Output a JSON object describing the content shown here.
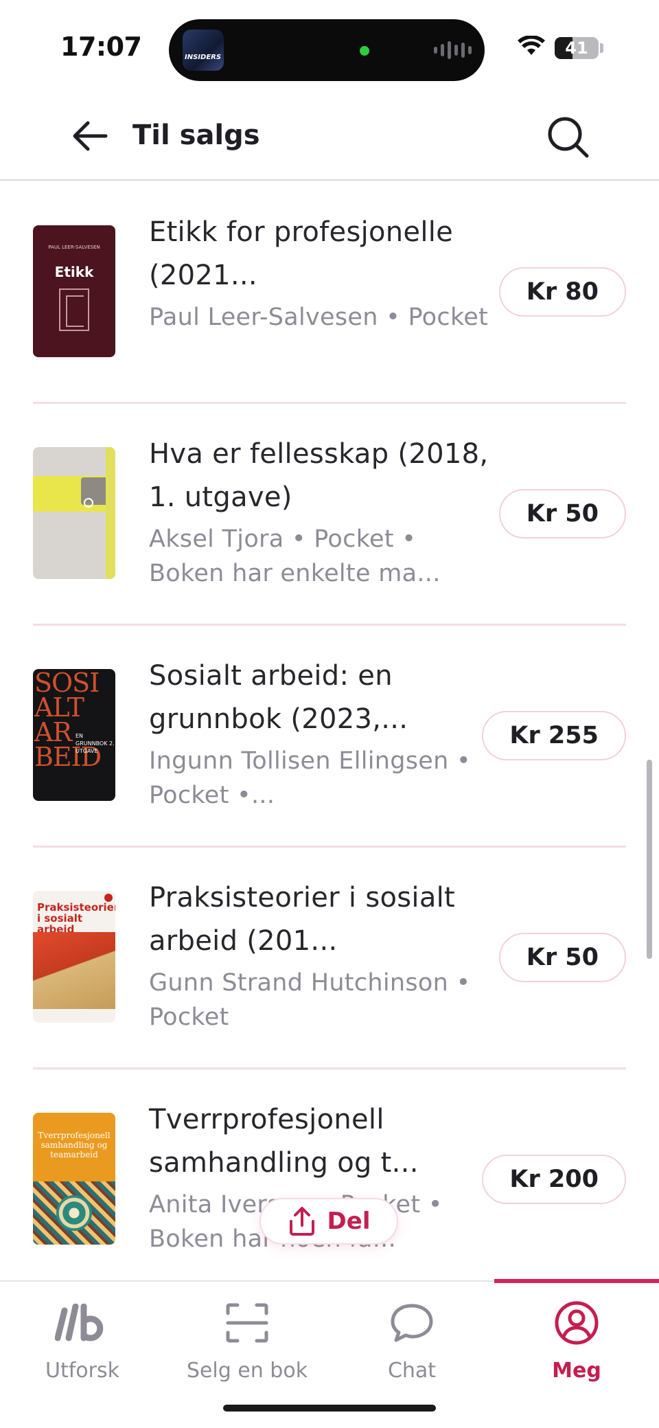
{
  "status_bar": {
    "time": "17:07",
    "battery": "41",
    "media_label": "INSIDERS"
  },
  "header": {
    "title": "Til salgs"
  },
  "listings": [
    {
      "title": "Etikk for profesjonelle (2021...",
      "meta": "Paul Leer-Salvesen • Pocket",
      "price": "Kr 80"
    },
    {
      "title": "Hva er fellesskap (2018, 1. utgave)",
      "meta": "Aksel Tjora • Pocket • Boken har enkelte ma...",
      "price": "Kr 50"
    },
    {
      "title": "Sosialt arbeid: en grunnbok (2023,...",
      "meta": "Ingunn Tollisen Ellingsen • Pocket •...",
      "price": "Kr 255"
    },
    {
      "title": "Praksisteorier i sosialt arbeid (201...",
      "meta": "Gunn Strand Hutchinson • Pocket",
      "price": "Kr 50"
    },
    {
      "title": "Tverrprofesjonell samhandling og t...",
      "meta": "Anita Iversen • Pocket • Boken har noen få...",
      "price": "Kr 200"
    }
  ],
  "covers": {
    "etikk": {
      "top": "PAUL LEER-SALVESEN",
      "title": "Etikk"
    },
    "hva": {},
    "sosialt": {
      "big": "SOSI ALT AR BEID",
      "side": "EN GRUNNBOK 2. UTGAVE"
    },
    "praksis": {
      "title": "Praksisteorier i sosialt arbeid"
    },
    "tverr": {
      "title": "Tverrprofesjonell samhandling og teamarbeid"
    }
  },
  "share": {
    "label": "Del"
  },
  "bottom_nav": {
    "items": [
      {
        "label": "Utforsk",
        "icon": "explore-logo-icon"
      },
      {
        "label": "Selg en bok",
        "icon": "scan-icon"
      },
      {
        "label": "Chat",
        "icon": "chat-bubble-icon"
      },
      {
        "label": "Meg",
        "icon": "profile-icon"
      }
    ],
    "active_index": 3
  },
  "colors": {
    "accent": "#c41e4f",
    "divider": "#f7dde4",
    "muted_text": "#8e8b96"
  }
}
